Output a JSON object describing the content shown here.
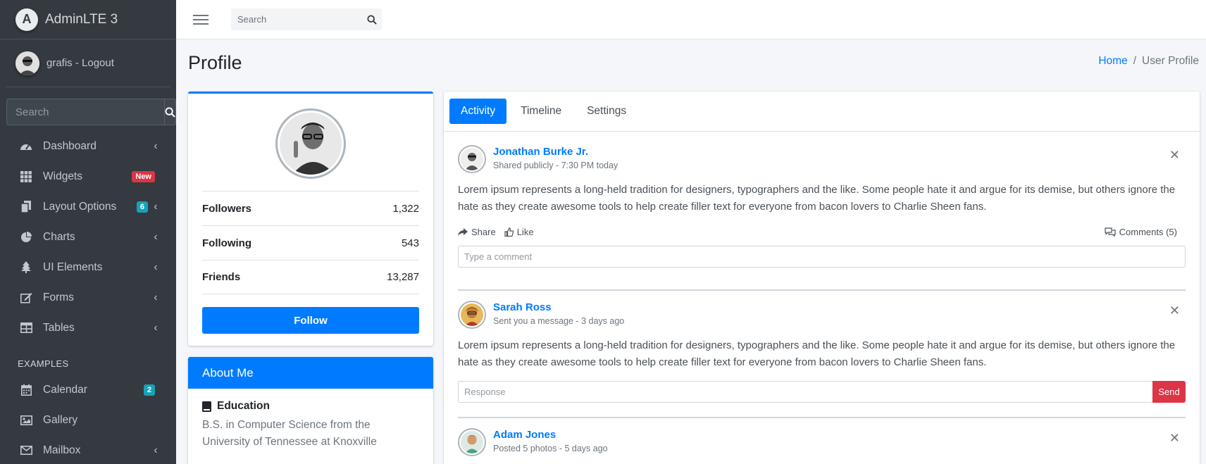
{
  "brand": {
    "title": "AdminLTE 3",
    "logo_letter": "A"
  },
  "user": {
    "name": "grafis - Logout"
  },
  "sidebar": {
    "search_placeholder": "Search",
    "items": [
      {
        "label": "Dashboard",
        "icon": "tachometer-icon",
        "badge": "",
        "arrow": true
      },
      {
        "label": "Widgets",
        "icon": "grid-icon",
        "badge": "New",
        "badge_color": "#dc3545",
        "arrow": false
      },
      {
        "label": "Layout Options",
        "icon": "copy-icon",
        "badge": "6",
        "badge_color": "#17a2b8",
        "arrow": true
      },
      {
        "label": "Charts",
        "icon": "pie-chart-icon",
        "badge": "",
        "arrow": true
      },
      {
        "label": "UI Elements",
        "icon": "tree-icon",
        "badge": "",
        "arrow": true
      },
      {
        "label": "Forms",
        "icon": "edit-icon",
        "badge": "",
        "arrow": true
      },
      {
        "label": "Tables",
        "icon": "table-icon",
        "badge": "",
        "arrow": true
      }
    ],
    "header": "EXAMPLES",
    "examples": [
      {
        "label": "Calendar",
        "icon": "calendar-icon",
        "badge": "2",
        "badge_color": "#17a2b8",
        "arrow": false
      },
      {
        "label": "Gallery",
        "icon": "image-icon",
        "badge": "",
        "arrow": false
      },
      {
        "label": "Mailbox",
        "icon": "envelope-icon",
        "badge": "",
        "arrow": true
      }
    ]
  },
  "topbar": {
    "search_placeholder": "Search"
  },
  "page": {
    "title": "Profile"
  },
  "breadcrumb": {
    "home": "Home",
    "separator": "/",
    "current": "User Profile"
  },
  "profile": {
    "stats": [
      {
        "label": "Followers",
        "value": "1,322"
      },
      {
        "label": "Following",
        "value": "543"
      },
      {
        "label": "Friends",
        "value": "13,287"
      }
    ],
    "follow_label": "Follow"
  },
  "about": {
    "title": "About Me",
    "education_title": "Education",
    "education_text": "B.S. in Computer Science from the University of Tennessee at Knoxville"
  },
  "tabs": [
    "Activity",
    "Timeline",
    "Settings"
  ],
  "posts": [
    {
      "user": "Jonathan Burke Jr.",
      "desc": "Shared publicly - 7:30 PM today",
      "text": "Lorem ipsum represents a long-held tradition for designers, typographers and the like. Some people hate it and argue for its demise, but others ignore the hate as they create awesome tools to help create filler text for everyone from bacon lovers to Charlie Sheen fans.",
      "share": "Share",
      "like": "Like",
      "comments": "Comments (5)",
      "comment_placeholder": "Type a comment"
    },
    {
      "user": "Sarah Ross",
      "desc": "Sent you a message - 3 days ago",
      "text": "Lorem ipsum represents a long-held tradition for designers, typographers and the like. Some people hate it and argue for its demise, but others ignore the hate as they create awesome tools to help create filler text for everyone from bacon lovers to Charlie Sheen fans.",
      "response_placeholder": "Response",
      "send": "Send"
    },
    {
      "user": "Adam Jones",
      "desc": "Posted 5 photos - 5 days ago"
    }
  ],
  "colors": {
    "primary": "#007bff",
    "danger": "#dc3545",
    "info": "#17a2b8",
    "sidebar_bg": "#343a40"
  }
}
